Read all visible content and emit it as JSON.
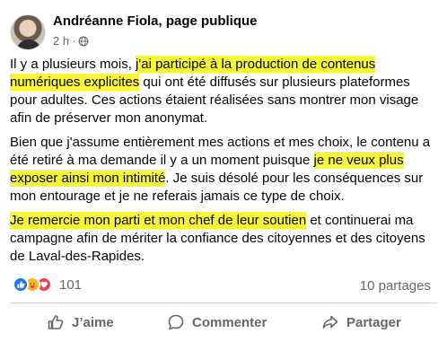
{
  "post": {
    "author": "Andréanne Fiola, page publique",
    "time": "2 h",
    "separator": "·",
    "paragraphs": [
      {
        "segments": [
          {
            "text": "Il y a plusieurs mois, ",
            "highlight": false
          },
          {
            "text": "j'ai participé à la production de contenus numériques explicites",
            "highlight": true
          },
          {
            "text": " qui ont été diffusés sur plusieurs plateformes pour adultes. Ces actions étaient réalisées sans montrer mon visage afin de préserver mon anonymat.",
            "highlight": false
          }
        ]
      },
      {
        "segments": [
          {
            "text": "Bien que j'assume entièrement mes actions et mes choix, le contenu a été retiré à ma demande il y a un moment puisque ",
            "highlight": false
          },
          {
            "text": "je ne veux plus exposer ainsi mon intimité",
            "highlight": true
          },
          {
            "text": ". Je suis désolé pour les conséquences sur mon entourage et je ne referais jamais ce type de choix.",
            "highlight": false
          }
        ]
      },
      {
        "segments": [
          {
            "text": "Je remercie mon parti et mon chef de leur soutien",
            "highlight": true
          },
          {
            "text": " et continuerai ma campagne afin de mériter la confiance des citoyennes et des citoyens de Laval-des-Rapides.",
            "highlight": false
          }
        ]
      }
    ],
    "highlight_color": "#f6f53a",
    "reactions": {
      "icons": [
        "like-icon",
        "care-icon",
        "love-icon"
      ],
      "count": "101"
    },
    "shares": "10 partages",
    "actions": {
      "like": "J’aime",
      "comment": "Commenter",
      "share": "Partager"
    }
  }
}
